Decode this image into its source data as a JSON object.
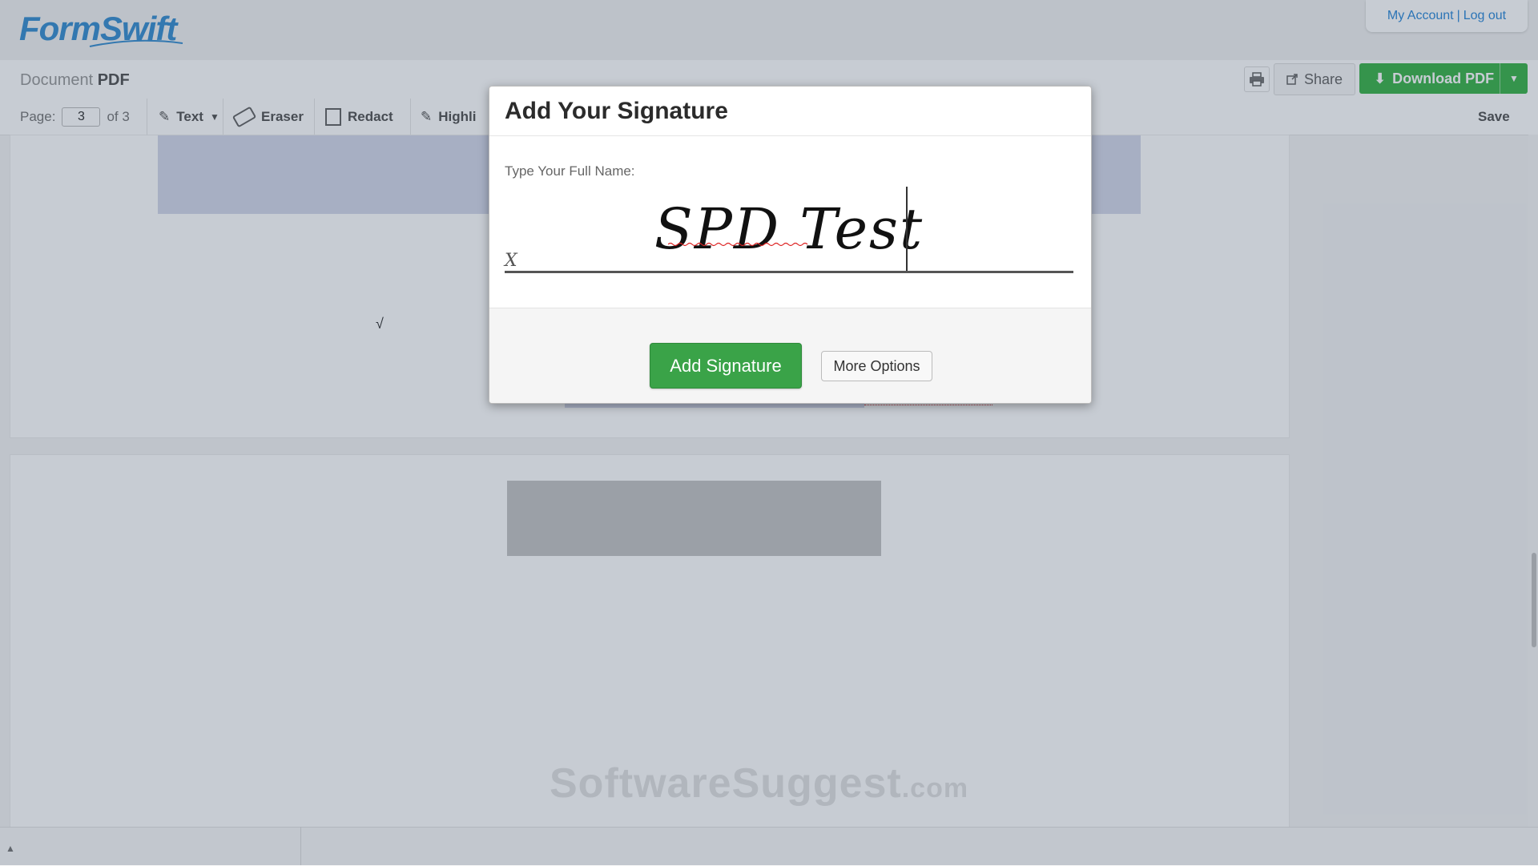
{
  "header": {
    "logo_text": "FormSwift",
    "account": {
      "my_account": "My Account",
      "separator": "|",
      "log_out": "Log out"
    }
  },
  "titlebar": {
    "doc_title_prefix": "Document",
    "doc_title_type": "PDF",
    "print_icon": "printer-icon",
    "share_label": "Share",
    "download_label": "Download PDF"
  },
  "toolbar": {
    "page_label": "Page:",
    "page_value": "3",
    "page_total": "of 3",
    "text_label": "Text",
    "eraser_label": "Eraser",
    "redact_label": "Redact",
    "highlight_label": "Highli",
    "save_label": "Save"
  },
  "document": {
    "checkmark": "√"
  },
  "modal": {
    "title": "Add Your Signature",
    "name_label": "Type Your Full Name:",
    "signature_value": "SPD Test",
    "x_mark": "X",
    "add_button": "Add Signature",
    "more_button": "More Options"
  },
  "watermark": {
    "main": "SoftwareSuggest",
    "suffix": ".com"
  },
  "colors": {
    "accent_blue": "#2f8ad8",
    "download_green": "#3cb44b",
    "add_signature_green": "#3aa348"
  }
}
